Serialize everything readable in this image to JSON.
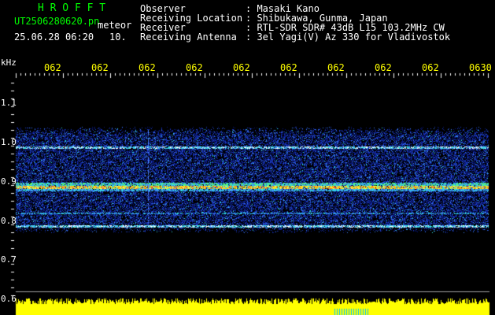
{
  "header": {
    "app_title": "H R O F F T",
    "filename": "UT2506280620.pn",
    "mode": "meteor",
    "datetime": "25.06.28 06:20",
    "interval": "10.",
    "labels": [
      "Observer",
      "Receiving Location",
      "Receiver",
      "Receiving Antenna"
    ],
    "values": [
      ": Masaki Kano",
      ": Shibukawa, Gunma, Japan",
      ": RTL-SDR SDR# 43dB L15 103.2MHz CW",
      ": 3el Yagi(V) Az 330 for Vladivostok"
    ]
  },
  "time_axis": {
    "ticks": [
      "062",
      "062",
      "062",
      "062",
      "062",
      "062",
      "062",
      "062",
      "062",
      "0630"
    ]
  },
  "freq_axis": {
    "unit": "kHz",
    "ticks": [
      "1.1",
      "1.0",
      "0.9",
      "0.8",
      "0.7",
      "0.6"
    ]
  },
  "colors": {
    "title": "#00ff00",
    "text": "#ffffff",
    "ticks": "#ffff00",
    "background": "#000000",
    "band": "#4060a0"
  }
}
